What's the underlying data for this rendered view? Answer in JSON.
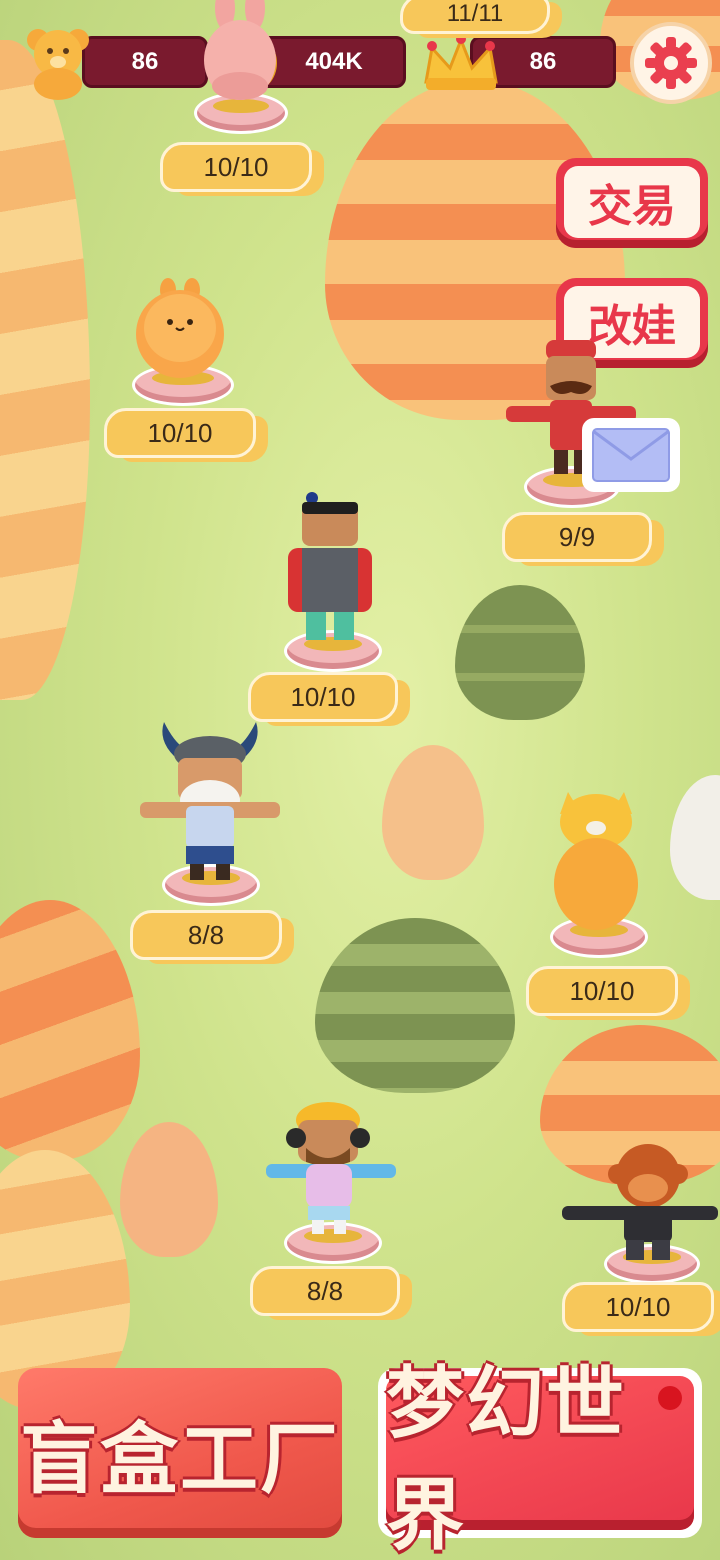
{
  "hud": {
    "bears": "86",
    "coins": "404K",
    "crowns": "86",
    "top_partial_label": "11/11"
  },
  "side_buttons": {
    "trade": "交易",
    "modify": "改娃"
  },
  "figures": [
    {
      "name": "bunny",
      "count": "10/10"
    },
    {
      "name": "orange-blob",
      "count": "10/10"
    },
    {
      "name": "mustache-guard",
      "count": "9/9"
    },
    {
      "name": "armored-warrior",
      "count": "10/10"
    },
    {
      "name": "viking",
      "count": "8/8"
    },
    {
      "name": "yellow-cat",
      "count": "10/10"
    },
    {
      "name": "headphone-boy",
      "count": "8/8"
    },
    {
      "name": "monkey",
      "count": "10/10"
    }
  ],
  "bottom": {
    "factory": "盲盒工厂",
    "dream_world": "梦幻世界"
  },
  "colors": {
    "accent_red": "#e8374a",
    "label_yellow": "#f7c75a",
    "stat_bg": "#7a1a2e"
  }
}
